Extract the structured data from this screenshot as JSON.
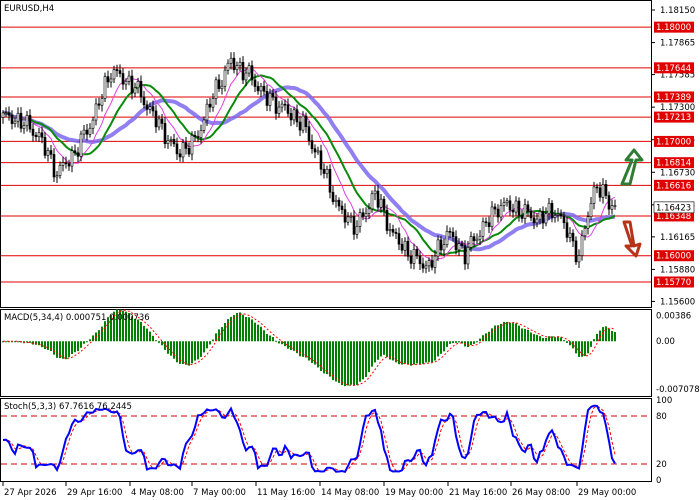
{
  "chart_data": [
    {
      "type": "candlestick",
      "title": "EURUSD,H4",
      "panel": "price",
      "y_axis_ticks": [
        "1.18150",
        "1.17865",
        "1.17585",
        "1.17300",
        "1.17015",
        "1.16730",
        "1.16445",
        "1.16165",
        "1.15880",
        "1.15600"
      ],
      "ylim": [
        1.1556,
        1.1822
      ],
      "level_lines": [
        {
          "label": "1.18000",
          "value": 1.18
        },
        {
          "label": "1.17644",
          "value": 1.17644
        },
        {
          "label": "1.17389",
          "value": 1.17389
        },
        {
          "label": "1.17213",
          "value": 1.17213
        },
        {
          "label": "1.17000",
          "value": 1.17
        },
        {
          "label": "1.16814",
          "value": 1.16814
        },
        {
          "label": "1.16616",
          "value": 1.16616
        },
        {
          "label": "1.16348",
          "value": 1.16348
        },
        {
          "label": "1.16000",
          "value": 1.16
        },
        {
          "label": "1.15770",
          "value": 1.1577
        }
      ],
      "current_price_label": "1.16423",
      "current_price": 1.16423,
      "moving_average_colors": [
        "#7b68ee",
        "#0a8a0a",
        "#e040e0"
      ],
      "arrow_up_color": "#2e7d32",
      "arrow_down_color": "#b5341a",
      "close_anchors": [
        [
          0,
          1.1722
        ],
        [
          6,
          1.1718
        ],
        [
          12,
          1.1705
        ],
        [
          18,
          1.1672
        ],
        [
          24,
          1.169
        ],
        [
          30,
          1.172
        ],
        [
          36,
          1.1762
        ],
        [
          44,
          1.1748
        ],
        [
          52,
          1.1715
        ],
        [
          58,
          1.169
        ],
        [
          64,
          1.17
        ],
        [
          70,
          1.174
        ],
        [
          76,
          1.177
        ],
        [
          82,
          1.1758
        ],
        [
          88,
          1.1738
        ],
        [
          94,
          1.1728
        ],
        [
          100,
          1.1715
        ],
        [
          106,
          1.168
        ],
        [
          112,
          1.164
        ],
        [
          118,
          1.1625
        ],
        [
          124,
          1.1655
        ],
        [
          130,
          1.1618
        ],
        [
          136,
          1.16
        ],
        [
          142,
          1.159
        ],
        [
          148,
          1.162
        ],
        [
          154,
          1.1602
        ],
        [
          160,
          1.1625
        ],
        [
          166,
          1.1645
        ],
        [
          172,
          1.164
        ],
        [
          178,
          1.1632
        ],
        [
          184,
          1.164
        ],
        [
          188,
          1.1622
        ],
        [
          192,
          1.1598
        ],
        [
          196,
          1.165
        ],
        [
          198,
          1.166
        ],
        [
          202,
          1.1648
        ],
        [
          204,
          1.1642
        ]
      ]
    },
    {
      "type": "histogram",
      "panel": "macd",
      "label": "MACD(5,34,4) 0.000751 0.000736",
      "y_axis_ticks": [
        "0.00386",
        "0.00",
        "-0.007078"
      ],
      "ylim": [
        -0.008,
        0.0045
      ],
      "bar_color": "#008000",
      "signal_color": "#ff0000"
    },
    {
      "type": "line",
      "panel": "stochastic",
      "label": "Stoch(5,3,3) 67.7616 76.2445",
      "y_axis_ticks": [
        "100",
        "80",
        "20",
        "0"
      ],
      "ylim": [
        0,
        100
      ],
      "levels": [
        80,
        20
      ],
      "main_color": "#0000ff",
      "signal_color": "#ff0000"
    }
  ],
  "x_axis_labels": [
    "27 Apr 2026",
    "29 Apr 16:00",
    "4 May 08:00",
    "7 May 00:00",
    "11 May 16:00",
    "14 May 08:00",
    "19 May 00:00",
    "21 May 16:00",
    "26 May 08:00",
    "29 May 00:00"
  ]
}
